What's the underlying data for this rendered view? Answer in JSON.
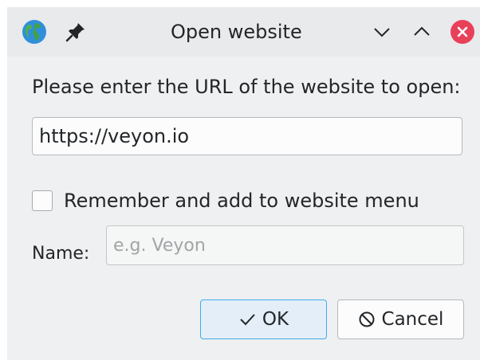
{
  "window": {
    "title": "Open website",
    "icons": {
      "app": "globe-icon",
      "pin": "pin-icon",
      "minimize": "chevron-down-icon",
      "maximize": "chevron-up-icon",
      "close": "close-icon"
    },
    "close_color": "#e9405a"
  },
  "form": {
    "prompt": "Please enter the URL of the website to open:",
    "url_value": "https://veyon.io",
    "remember_label": "Remember and add to website menu",
    "remember_checked": false,
    "name_label": "Name:",
    "name_value": "",
    "name_placeholder": "e.g. Veyon"
  },
  "buttons": {
    "ok_label": "OK",
    "ok_icon": "checkmark-icon",
    "cancel_label": "Cancel",
    "cancel_icon": "cancel-icon",
    "accent": "#3daee9"
  }
}
